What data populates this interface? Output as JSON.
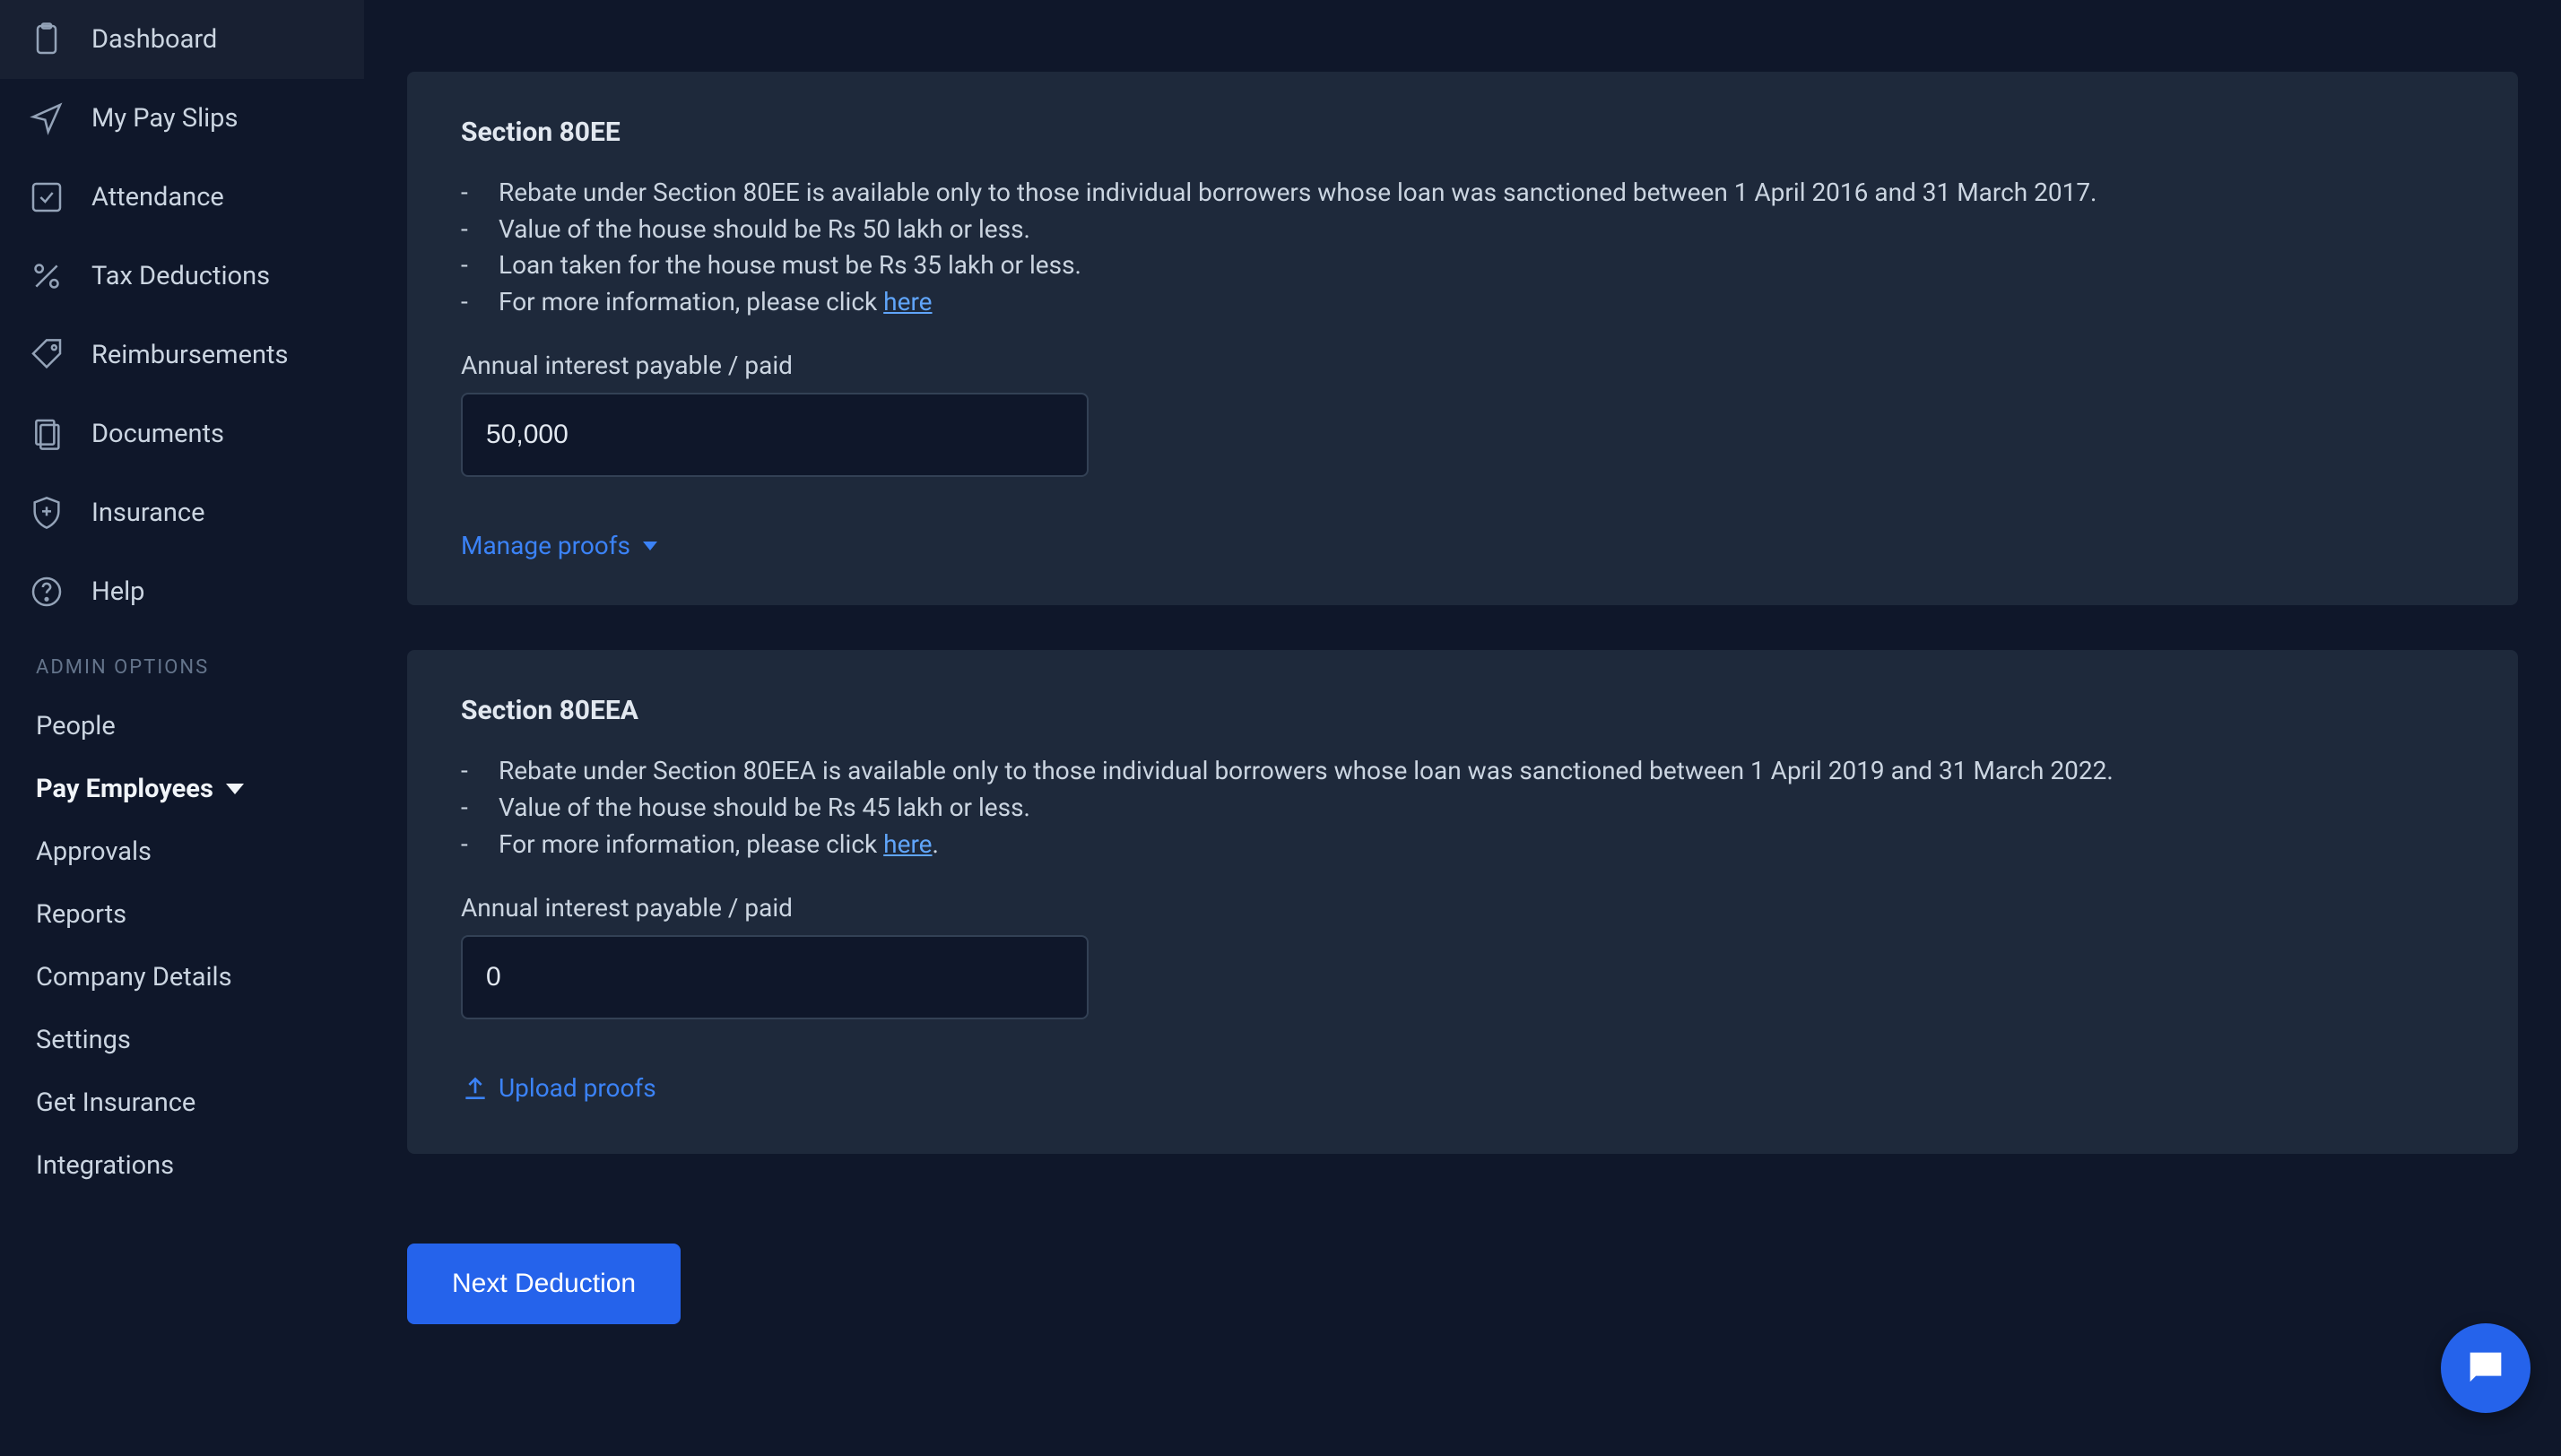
{
  "sidebar": {
    "nav": [
      {
        "label": "Dashboard"
      },
      {
        "label": "My Pay Slips"
      },
      {
        "label": "Attendance"
      },
      {
        "label": "Tax Deductions"
      },
      {
        "label": "Reimbursements"
      },
      {
        "label": "Documents"
      },
      {
        "label": "Insurance"
      },
      {
        "label": "Help"
      }
    ],
    "admin_header": "ADMIN OPTIONS",
    "admin": [
      {
        "label": "People"
      },
      {
        "label": "Pay Employees",
        "bold": true,
        "chevron": true
      },
      {
        "label": "Approvals"
      },
      {
        "label": "Reports"
      },
      {
        "label": "Company Details"
      },
      {
        "label": "Settings"
      },
      {
        "label": "Get Insurance"
      },
      {
        "label": "Integrations"
      }
    ]
  },
  "section80ee": {
    "title": "Section 80EE",
    "bullets": {
      "b0": "Rebate under Section 80EE is available only to those individual borrowers whose loan was sanctioned between 1 April 2016 and 31 March 2017.",
      "b1": "Value of the house should be Rs 50 lakh or less.",
      "b2": "Loan taken for the house must be Rs 35 lakh or less.",
      "b3_prefix": "For more information, please click ",
      "b3_link": "here"
    },
    "field_label": "Annual interest payable / paid",
    "value": "50,000",
    "proofs_label": "Manage proofs"
  },
  "section80eea": {
    "title": "Section 80EEA",
    "bullets": {
      "b0": "Rebate under Section 80EEA is available only to those individual borrowers whose loan was sanctioned between 1 April 2019 and 31 March 2022.",
      "b1": "Value of the house should be Rs 45 lakh or less.",
      "b2_prefix": "For more information, please click ",
      "b2_link": "here",
      "b2_suffix": "."
    },
    "field_label": "Annual interest payable / paid",
    "value": "0",
    "proofs_label": "Upload proofs"
  },
  "next_button": "Next Deduction"
}
